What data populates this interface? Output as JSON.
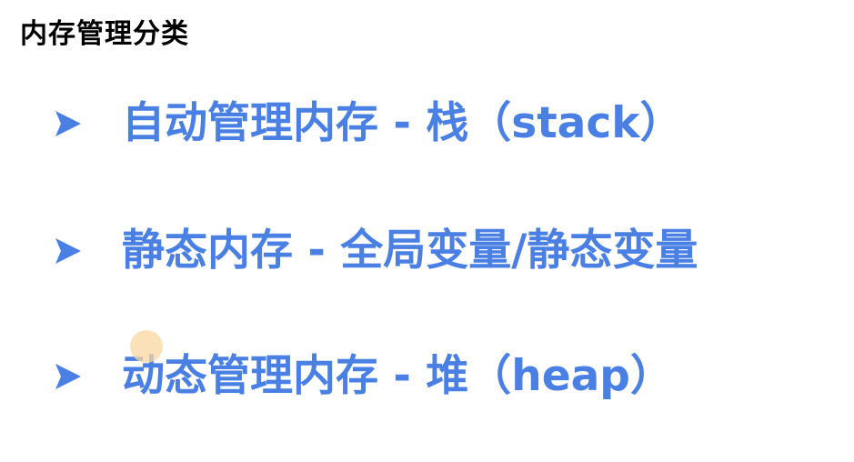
{
  "slide": {
    "title": "内存管理分类",
    "accent_color": "#4a7fe3",
    "items": [
      {
        "text": "自动管理内存 - 栈（stack）",
        "marker_icon": "arrow-bullet-icon"
      },
      {
        "text": "静态内存 - 全局变量/静态变量",
        "marker_icon": "arrow-bullet-icon"
      },
      {
        "text": "动态管理内存 - 堆（heap）",
        "marker_icon": "arrow-bullet-icon"
      }
    ]
  },
  "cursor": {
    "icon": "cursor-highlight-icon",
    "color": "#fad7a0"
  }
}
